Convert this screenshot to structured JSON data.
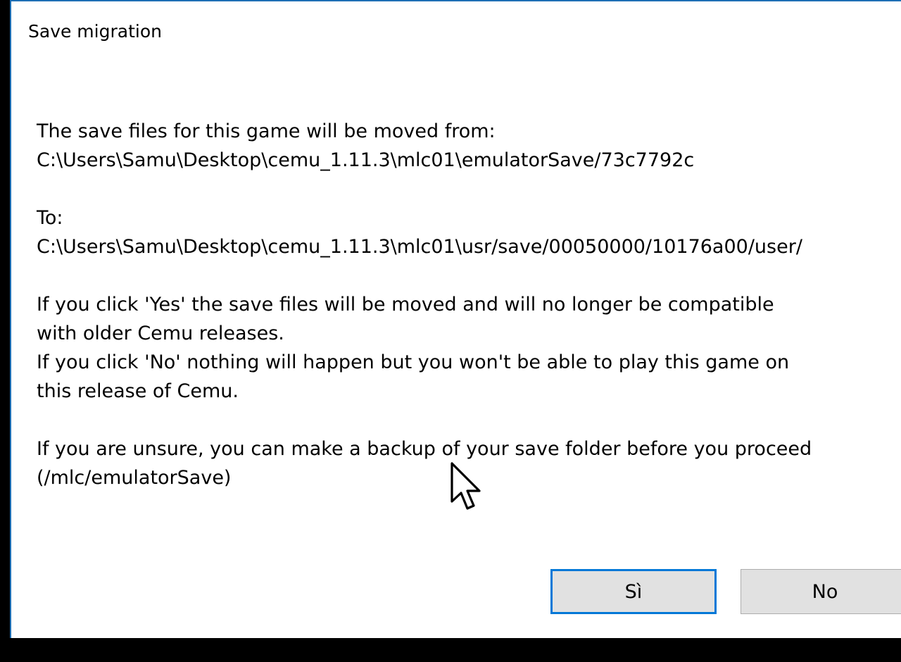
{
  "dialog": {
    "title": "Save migration",
    "message": {
      "from_label": "The save files for this game will be moved from:",
      "from_path": "C:\\Users\\Samu\\Desktop\\cemu_1.11.3\\mlc01\\emulatorSave/73c7792c",
      "to_label": "To:",
      "to_path": "C:\\Users\\Samu\\Desktop\\cemu_1.11.3\\mlc01\\usr/save/00050000/10176a00/user/",
      "yes_line_1": "If you click 'Yes' the save files will be moved and will no longer be compatible",
      "yes_line_2": "with older Cemu releases.",
      "no_line_1": "If you click 'No' nothing will happen but you won't be able to play this game on",
      "no_line_2": "this release of Cemu.",
      "unsure_line_1": "If you are unsure, you can make a backup of your save folder before you proceed",
      "unsure_line_2": "(/mlc/emulatorSave)"
    },
    "buttons": {
      "yes_label": "Sì",
      "no_label": "No"
    }
  },
  "cursor_icon": "arrow-cursor-icon",
  "colors": {
    "accent": "#0078d7",
    "window_border": "#1e6fb5",
    "button_face": "#e1e1e1",
    "background": "#000000"
  }
}
